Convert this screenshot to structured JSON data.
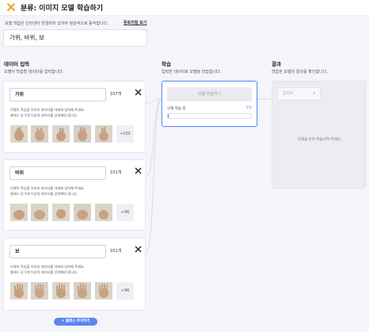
{
  "header": {
    "title": "분류: 이미지 모델 학습하기"
  },
  "intro": {
    "description": "모델 학습은 인터넷이 연결되어 있어야 정상적으로 동작합니다.",
    "tutorial_link": "튜토리얼 보기"
  },
  "model_title": "가위, 바위, 보",
  "data_input": {
    "title": "데이터 입력",
    "subtitle": "모델이 학습할 데이터를 입력합니다.",
    "classes": [
      {
        "name": "가위",
        "count": "107개",
        "desc_line1": "모델이 학습할 이미지 데이터를 아래에 입력해 주세요.",
        "desc_line2": "클래스 당 5개 이상의 데이터를 입력해야 합니다.",
        "more": "+102"
      },
      {
        "name": "바위",
        "count": "101개",
        "desc_line1": "모델이 학습할 이미지 데이터를 아래에 입력해 주세요.",
        "desc_line2": "클래스 당 5개 이상의 데이터를 입력해야 합니다.",
        "more": "+96"
      },
      {
        "name": "보",
        "count": "101개",
        "desc_line1": "모델이 학습할 이미지 데이터를 아래에 입력해 주세요.",
        "desc_line2": "클래스 당 5개 이상의 데이터를 입력해야 합니다.",
        "more": "+96"
      }
    ],
    "add_class_button": "+ 클래스 추가하기"
  },
  "training": {
    "title": "학습",
    "subtitle": "입력한 데이터로 모델을 학습합니다.",
    "train_button": "모델 학습하기",
    "progress_label": "모델 학습 중",
    "progress_percent": "1%",
    "progress_fraction": 0.01
  },
  "result": {
    "title": "결과",
    "subtitle": "학습한 모델의 결과를 확인합니다.",
    "input_select": "입력도",
    "message": "모델을 먼저 학습시켜 주세요."
  },
  "colors": {
    "accent": "#5b85f0",
    "close_icon": "#ffb02e"
  }
}
